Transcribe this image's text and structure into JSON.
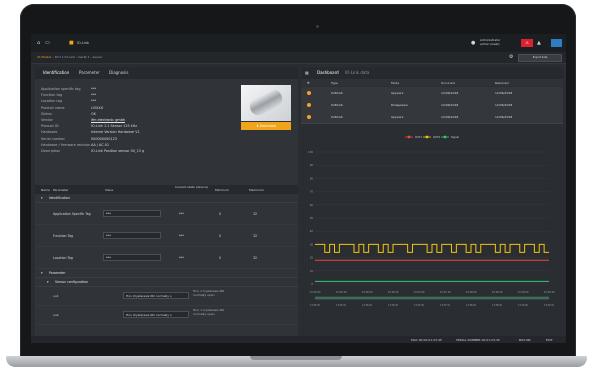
{
  "app": {
    "brand": "IO-Link",
    "user": [
      "Administrator",
      "admin (Gast)"
    ]
  },
  "breadcrumb": {
    "highlight": "IO-Master",
    "rest": "› Port 1 IO-Link › Gerät 1 › sensor"
  },
  "pathbar": {
    "button": "Export data"
  },
  "tabs": [
    "Identification",
    "Parameter",
    "Diagnosis"
  ],
  "info": [
    {
      "k": "Application specific tag",
      "v": "***"
    },
    {
      "k": "Function tag",
      "v": "***"
    },
    {
      "k": "Location tag",
      "v": "***"
    },
    {
      "k": "Product name",
      "v": "LI5XXX"
    },
    {
      "k": "Status",
      "v": "OK"
    },
    {
      "k": "Vendor",
      "v": "ifm electronic gmbh",
      "link": true
    },
    {
      "k": "Product ID",
      "v": "IO-Link 1.1 Sensor 125 kHz"
    },
    {
      "k": "Hardware",
      "v": "Interne Version Hardware V1"
    },
    {
      "k": "Serial number",
      "v": "000000000123"
    },
    {
      "k": "Hardware / firmware revision",
      "v": "AA / AC.01"
    },
    {
      "k": "Description",
      "v": "IO-Link Position sensor 00_15 g"
    }
  ],
  "device_button": "Download",
  "ptable": {
    "headers": [
      "Name",
      "Parameter",
      "Value",
      "Current state (device)",
      "Minimum",
      "Maximum"
    ],
    "section1": "Identification",
    "rows": [
      {
        "name": "Application Specific Tag",
        "value": "***",
        "current": "***",
        "min": "0",
        "max": "32"
      },
      {
        "name": "Function Tag",
        "value": "***",
        "current": "***",
        "min": "0",
        "max": "32"
      },
      {
        "name": "Location Tag",
        "value": "***",
        "current": "***",
        "min": "0",
        "max": "32"
      }
    ],
    "section2": "Parameter",
    "sub": "Sensor configuration",
    "config_rows": [
      {
        "name": "ou1",
        "value": "Hno (hysteresis NO normally o",
        "note": "Hno = hysteresis NO normally open"
      },
      {
        "name": "ou2",
        "value": "Hno (hysteresis NO normally o",
        "note": "Hno = hysteresis NO normally open"
      }
    ]
  },
  "right": {
    "tabs": [
      "Dashboard",
      "IO-Link data"
    ],
    "events_header": [
      "Type",
      "Mode",
      "Occurred",
      "Resolved"
    ],
    "events": [
      {
        "type": "0x8CA0",
        "mode": "Appears",
        "occurred": "12/06/2018",
        "resolved": "12/06/2018"
      },
      {
        "type": "0x8CA0",
        "mode": "Disappears",
        "occurred": "12/06/2018",
        "resolved": "12/06/2018"
      },
      {
        "type": "0x8CA0",
        "mode": "Appears",
        "occurred": "12/06/2018",
        "resolved": "12/06/2018"
      }
    ]
  },
  "chart_data": {
    "type": "line",
    "legend": [
      "OUT1",
      "OUT2",
      "Signal"
    ],
    "legend_colors": [
      "#e74c3c",
      "#f1c40f",
      "#2ecc71"
    ],
    "ylim": [
      0,
      100
    ],
    "yticks": [
      "100",
      "90",
      "80",
      "70",
      "60",
      "50",
      "40",
      "30",
      "20",
      "10",
      "0"
    ],
    "xticks": [
      "13:35:00",
      "13:35:30",
      "13:36:00",
      "13:36:30",
      "13:37:00",
      "13:37:30",
      "13:38:00",
      "13:38:30",
      "13:39:00",
      "13:39:30"
    ],
    "series": [
      {
        "name": "Signal",
        "color": "#f1c40f",
        "values": [
          30,
          30,
          24,
          30,
          24,
          30,
          30,
          30,
          24,
          30,
          24,
          30,
          30,
          24,
          30,
          24,
          30,
          30,
          30,
          24,
          30,
          30,
          30,
          24,
          30,
          24,
          30,
          30,
          24,
          30,
          30,
          24,
          30,
          24,
          30,
          30,
          30,
          24,
          30,
          24,
          30,
          30,
          24,
          30,
          30,
          24,
          30,
          24
        ]
      },
      {
        "name": "OUT1",
        "color": "#e74c3c",
        "values": [
          18,
          18,
          18,
          18,
          18,
          18,
          18,
          18,
          18,
          18
        ]
      },
      {
        "name": "OUT2",
        "color": "#2ecc71",
        "values": [
          2,
          2,
          2,
          2,
          2,
          2,
          2,
          2,
          2,
          2
        ]
      }
    ]
  },
  "status": [
    "MAC 00:02:01:23:45",
    "SERIAL NUMBER 00:01:23:45",
    "BUS-NR",
    "EXIT"
  ]
}
